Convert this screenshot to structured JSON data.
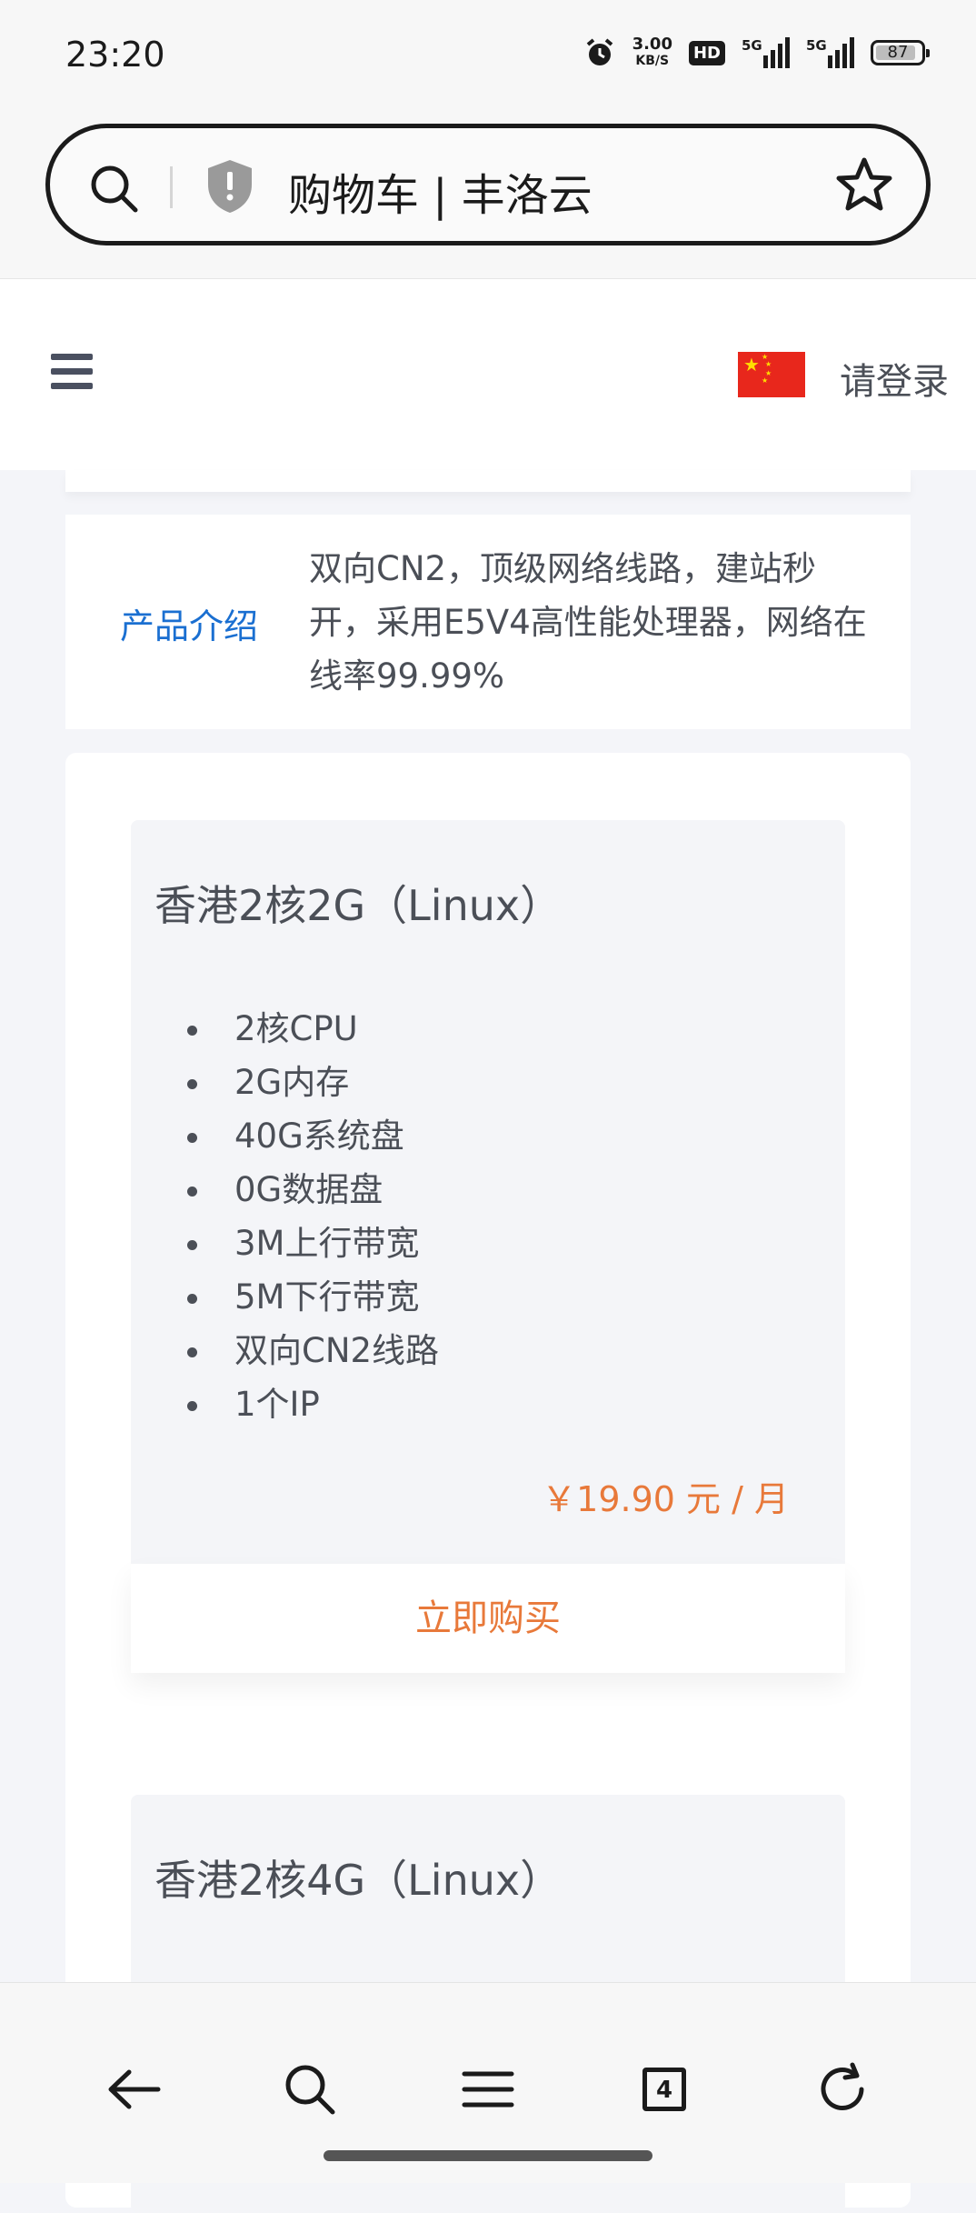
{
  "status_bar": {
    "time": "23:20",
    "net_speed_value": "3.00",
    "net_speed_unit": "KB/S",
    "hd_label": "HD",
    "sim1_label": "5G",
    "sim2_label": "5G",
    "battery": "87"
  },
  "browser": {
    "page_title": "购物车 | 丰洛云",
    "icons": [
      "search-icon",
      "shield-icon",
      "star-icon"
    ]
  },
  "site_header": {
    "login_label": "请登录",
    "flag": "china-flag"
  },
  "intro": {
    "label": "产品介绍",
    "text": "双向CN2，顶级网络线路，建站秒开，采用E5V4高性能处理器，网络在线率99.99%"
  },
  "products": [
    {
      "name": "香港2核2G（Linux）",
      "specs": [
        "2核CPU",
        "2G内存",
        "40G系统盘",
        "0G数据盘",
        "3M上行带宽",
        "5M下行带宽",
        "双向CN2线路",
        "1个IP"
      ],
      "price": "￥19.90 元 / 月",
      "buy_label": "立即购买"
    },
    {
      "name": "香港2核4G（Linux）"
    }
  ],
  "bottom_nav": {
    "tabs_count": "4",
    "icons": [
      "back-arrow-icon",
      "search-icon",
      "menu-icon",
      "tabs-icon",
      "refresh-icon"
    ]
  },
  "colors": {
    "accent_orange": "#e8793a",
    "link_blue": "#1a6fd1",
    "page_bg": "#f4f5f9"
  }
}
